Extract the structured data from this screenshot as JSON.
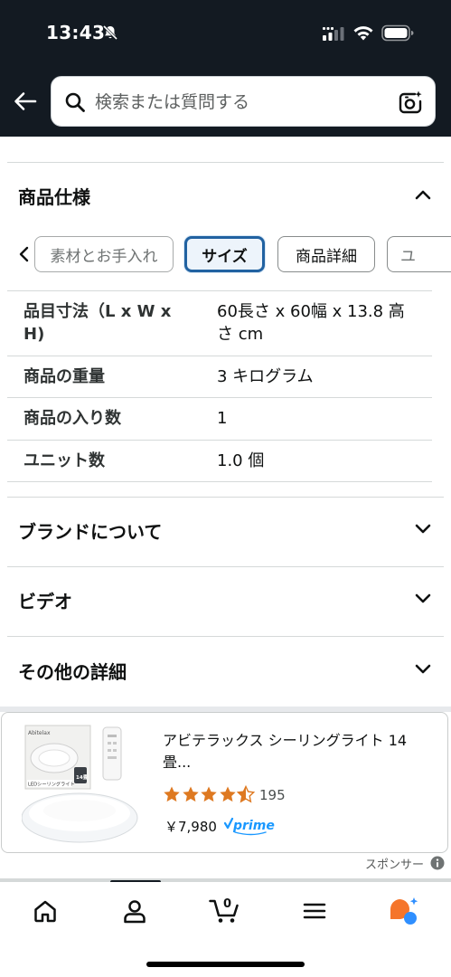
{
  "status_bar": {
    "time": "13:43"
  },
  "search": {
    "placeholder": "検索または質問する"
  },
  "product_spec": {
    "title": "商品仕様",
    "tabs": [
      {
        "label": "素材とお手入れ",
        "state": "muted"
      },
      {
        "label": "サイズ",
        "state": "active"
      },
      {
        "label": "商品詳細",
        "state": "normal"
      },
      {
        "label": "ユ",
        "state": "clipped"
      }
    ],
    "rows": [
      {
        "key": "品目寸法（L x W x H)",
        "value": "60長さ x 60幅 x 13.8 高さ cm"
      },
      {
        "key": "商品の重量",
        "value": "3 キログラム"
      },
      {
        "key": "商品の入り数",
        "value": "1"
      },
      {
        "key": "ユニット数",
        "value": "1.0 個"
      }
    ]
  },
  "sections": {
    "brand": "ブランドについて",
    "video": "ビデオ",
    "other": "その他の詳細"
  },
  "sponsored": {
    "title": "アビテラックス シーリングライト 14 畳...",
    "rating": 4.5,
    "rating_count": "195",
    "price": "￥7,980",
    "prime": "prime",
    "sponsor_label": "スポンサー",
    "image_texts": {
      "brand": "Abitelax",
      "badge_size": "14畳",
      "caption": "LEDシーリングライト"
    }
  },
  "bottom_nav": {
    "cart_count": "0",
    "items": [
      "home-icon",
      "account-icon",
      "cart-icon",
      "menu-icon",
      "rufus-icon"
    ]
  },
  "colors": {
    "header_bg": "#131a22",
    "active_tab_border": "#2162a1",
    "star": "#de7921",
    "prime_blue": "#1a98ff",
    "rufus_orange": "#f5752b",
    "rufus_blue": "#2f8fff"
  }
}
